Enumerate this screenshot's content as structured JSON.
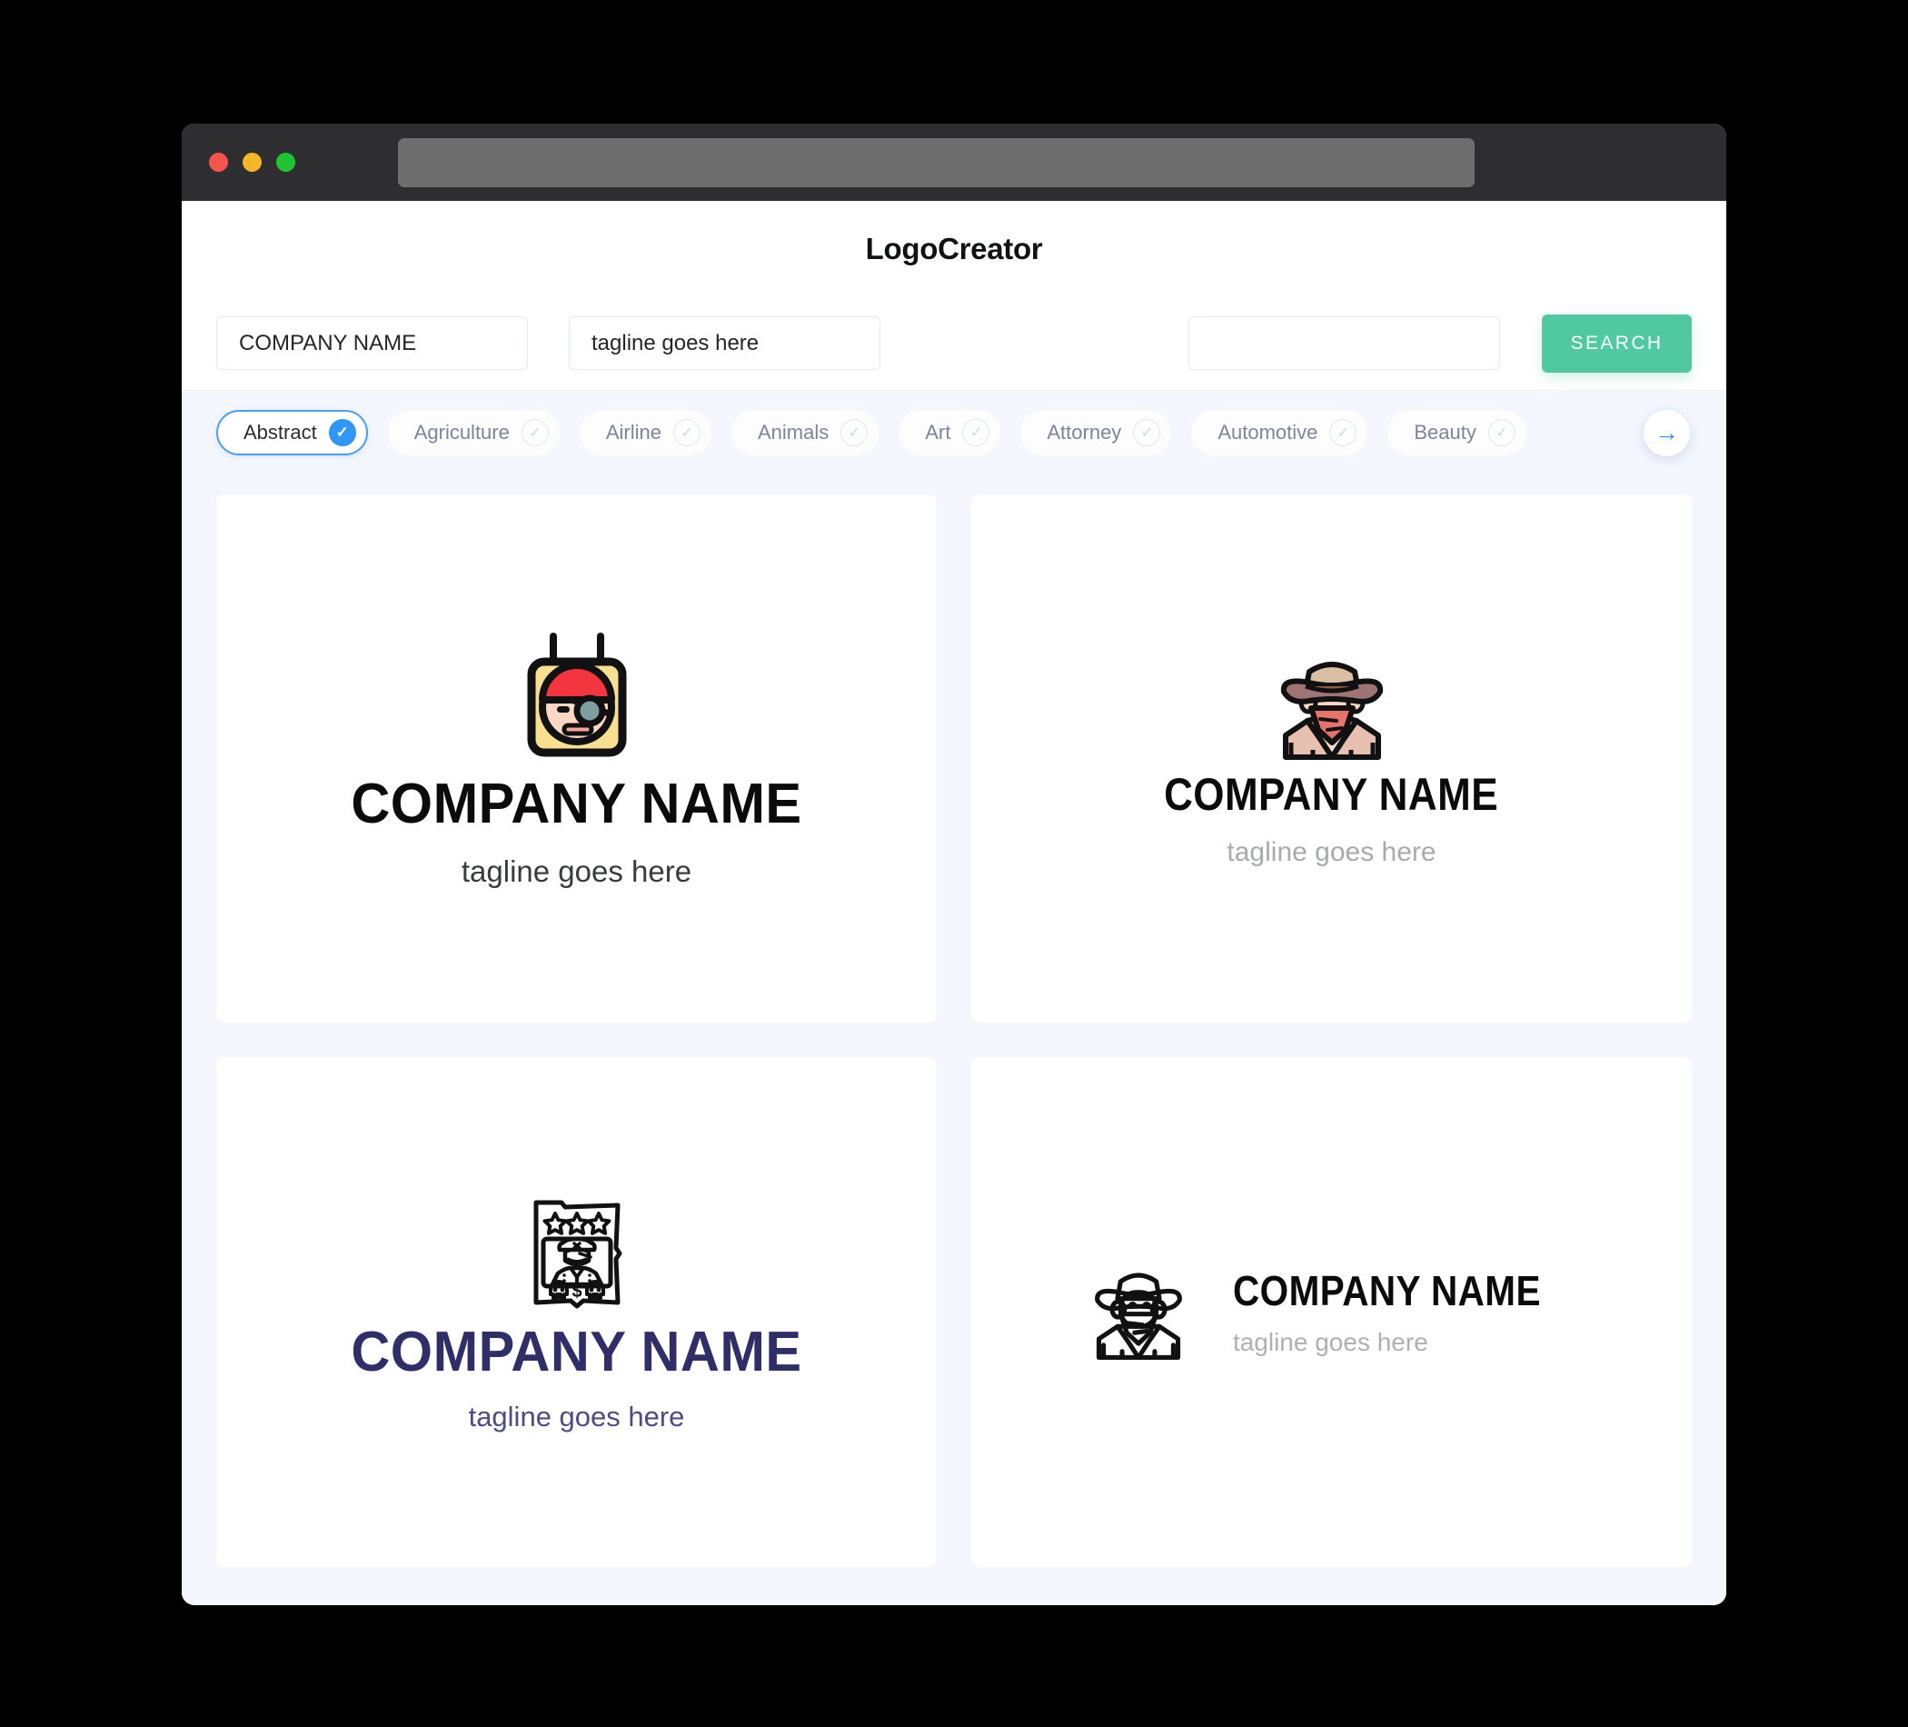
{
  "window": {
    "traffic_lights": [
      "close",
      "minimize",
      "maximize"
    ],
    "url_value": ""
  },
  "header": {
    "app_title": "LogoCreator"
  },
  "search": {
    "company_value": "COMPANY NAME",
    "company_placeholder": "COMPANY NAME",
    "tagline_value": "tagline goes here",
    "tagline_placeholder": "tagline goes here",
    "extra_value": "",
    "extra_placeholder": "",
    "search_button_label": "SEARCH",
    "search_button_color": "#51C9A0"
  },
  "categories": {
    "active_color": "#2F97F7",
    "next_arrow_icon": "arrow-right-icon",
    "items": [
      {
        "label": "Abstract",
        "selected": true
      },
      {
        "label": "Agriculture",
        "selected": false
      },
      {
        "label": "Airline",
        "selected": false
      },
      {
        "label": "Animals",
        "selected": false
      },
      {
        "label": "Art",
        "selected": false
      },
      {
        "label": "Attorney",
        "selected": false
      },
      {
        "label": "Automotive",
        "selected": false
      },
      {
        "label": "Beauty",
        "selected": false
      }
    ]
  },
  "results": {
    "cards": [
      {
        "icon": "pirate-badge-icon",
        "layout": "stacked",
        "name": "COMPANY NAME",
        "tagline": "tagline goes here",
        "name_color": "#0B0B0D",
        "tagline_color": "#3A3B3F"
      },
      {
        "icon": "cowboy-bandit-icon",
        "layout": "stacked",
        "name": "COMPANY NAME",
        "tagline": "tagline goes here",
        "name_color": "#0B0B0D",
        "tagline_color": "#A8AAAE"
      },
      {
        "icon": "wanted-poster-icon",
        "layout": "stacked",
        "name": "COMPANY NAME",
        "tagline": "tagline goes here",
        "name_color": "#2F2E69",
        "tagline_color": "#4D4C84"
      },
      {
        "icon": "cowboy-outline-icon",
        "layout": "horizontal",
        "name": "COMPANY NAME",
        "tagline": "tagline goes here",
        "name_color": "#0B0B0D",
        "tagline_color": "#AEB0B4"
      }
    ]
  }
}
